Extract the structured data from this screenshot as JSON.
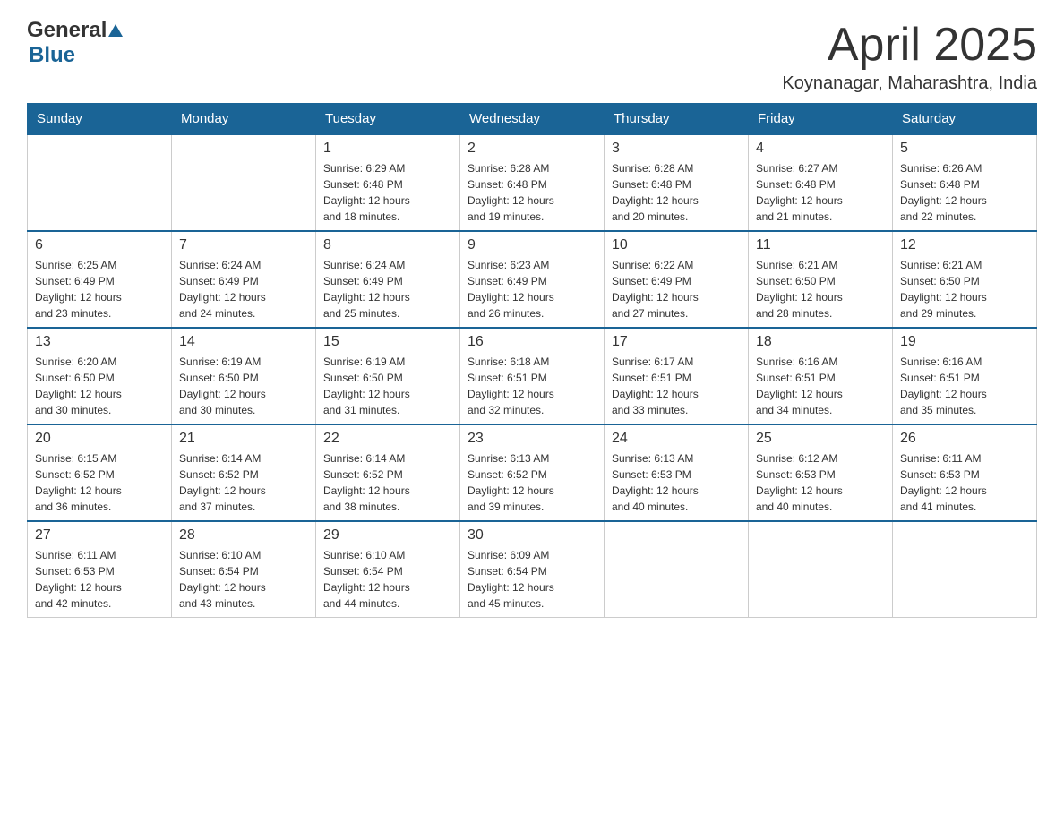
{
  "header": {
    "logo": {
      "general": "General",
      "blue": "Blue"
    },
    "title": "April 2025",
    "location": "Koynanagar, Maharashtra, India"
  },
  "calendar": {
    "days_of_week": [
      "Sunday",
      "Monday",
      "Tuesday",
      "Wednesday",
      "Thursday",
      "Friday",
      "Saturday"
    ],
    "weeks": [
      [
        {
          "day": "",
          "info": ""
        },
        {
          "day": "",
          "info": ""
        },
        {
          "day": "1",
          "info": "Sunrise: 6:29 AM\nSunset: 6:48 PM\nDaylight: 12 hours\nand 18 minutes."
        },
        {
          "day": "2",
          "info": "Sunrise: 6:28 AM\nSunset: 6:48 PM\nDaylight: 12 hours\nand 19 minutes."
        },
        {
          "day": "3",
          "info": "Sunrise: 6:28 AM\nSunset: 6:48 PM\nDaylight: 12 hours\nand 20 minutes."
        },
        {
          "day": "4",
          "info": "Sunrise: 6:27 AM\nSunset: 6:48 PM\nDaylight: 12 hours\nand 21 minutes."
        },
        {
          "day": "5",
          "info": "Sunrise: 6:26 AM\nSunset: 6:48 PM\nDaylight: 12 hours\nand 22 minutes."
        }
      ],
      [
        {
          "day": "6",
          "info": "Sunrise: 6:25 AM\nSunset: 6:49 PM\nDaylight: 12 hours\nand 23 minutes."
        },
        {
          "day": "7",
          "info": "Sunrise: 6:24 AM\nSunset: 6:49 PM\nDaylight: 12 hours\nand 24 minutes."
        },
        {
          "day": "8",
          "info": "Sunrise: 6:24 AM\nSunset: 6:49 PM\nDaylight: 12 hours\nand 25 minutes."
        },
        {
          "day": "9",
          "info": "Sunrise: 6:23 AM\nSunset: 6:49 PM\nDaylight: 12 hours\nand 26 minutes."
        },
        {
          "day": "10",
          "info": "Sunrise: 6:22 AM\nSunset: 6:49 PM\nDaylight: 12 hours\nand 27 minutes."
        },
        {
          "day": "11",
          "info": "Sunrise: 6:21 AM\nSunset: 6:50 PM\nDaylight: 12 hours\nand 28 minutes."
        },
        {
          "day": "12",
          "info": "Sunrise: 6:21 AM\nSunset: 6:50 PM\nDaylight: 12 hours\nand 29 minutes."
        }
      ],
      [
        {
          "day": "13",
          "info": "Sunrise: 6:20 AM\nSunset: 6:50 PM\nDaylight: 12 hours\nand 30 minutes."
        },
        {
          "day": "14",
          "info": "Sunrise: 6:19 AM\nSunset: 6:50 PM\nDaylight: 12 hours\nand 30 minutes."
        },
        {
          "day": "15",
          "info": "Sunrise: 6:19 AM\nSunset: 6:50 PM\nDaylight: 12 hours\nand 31 minutes."
        },
        {
          "day": "16",
          "info": "Sunrise: 6:18 AM\nSunset: 6:51 PM\nDaylight: 12 hours\nand 32 minutes."
        },
        {
          "day": "17",
          "info": "Sunrise: 6:17 AM\nSunset: 6:51 PM\nDaylight: 12 hours\nand 33 minutes."
        },
        {
          "day": "18",
          "info": "Sunrise: 6:16 AM\nSunset: 6:51 PM\nDaylight: 12 hours\nand 34 minutes."
        },
        {
          "day": "19",
          "info": "Sunrise: 6:16 AM\nSunset: 6:51 PM\nDaylight: 12 hours\nand 35 minutes."
        }
      ],
      [
        {
          "day": "20",
          "info": "Sunrise: 6:15 AM\nSunset: 6:52 PM\nDaylight: 12 hours\nand 36 minutes."
        },
        {
          "day": "21",
          "info": "Sunrise: 6:14 AM\nSunset: 6:52 PM\nDaylight: 12 hours\nand 37 minutes."
        },
        {
          "day": "22",
          "info": "Sunrise: 6:14 AM\nSunset: 6:52 PM\nDaylight: 12 hours\nand 38 minutes."
        },
        {
          "day": "23",
          "info": "Sunrise: 6:13 AM\nSunset: 6:52 PM\nDaylight: 12 hours\nand 39 minutes."
        },
        {
          "day": "24",
          "info": "Sunrise: 6:13 AM\nSunset: 6:53 PM\nDaylight: 12 hours\nand 40 minutes."
        },
        {
          "day": "25",
          "info": "Sunrise: 6:12 AM\nSunset: 6:53 PM\nDaylight: 12 hours\nand 40 minutes."
        },
        {
          "day": "26",
          "info": "Sunrise: 6:11 AM\nSunset: 6:53 PM\nDaylight: 12 hours\nand 41 minutes."
        }
      ],
      [
        {
          "day": "27",
          "info": "Sunrise: 6:11 AM\nSunset: 6:53 PM\nDaylight: 12 hours\nand 42 minutes."
        },
        {
          "day": "28",
          "info": "Sunrise: 6:10 AM\nSunset: 6:54 PM\nDaylight: 12 hours\nand 43 minutes."
        },
        {
          "day": "29",
          "info": "Sunrise: 6:10 AM\nSunset: 6:54 PM\nDaylight: 12 hours\nand 44 minutes."
        },
        {
          "day": "30",
          "info": "Sunrise: 6:09 AM\nSunset: 6:54 PM\nDaylight: 12 hours\nand 45 minutes."
        },
        {
          "day": "",
          "info": ""
        },
        {
          "day": "",
          "info": ""
        },
        {
          "day": "",
          "info": ""
        }
      ]
    ]
  }
}
